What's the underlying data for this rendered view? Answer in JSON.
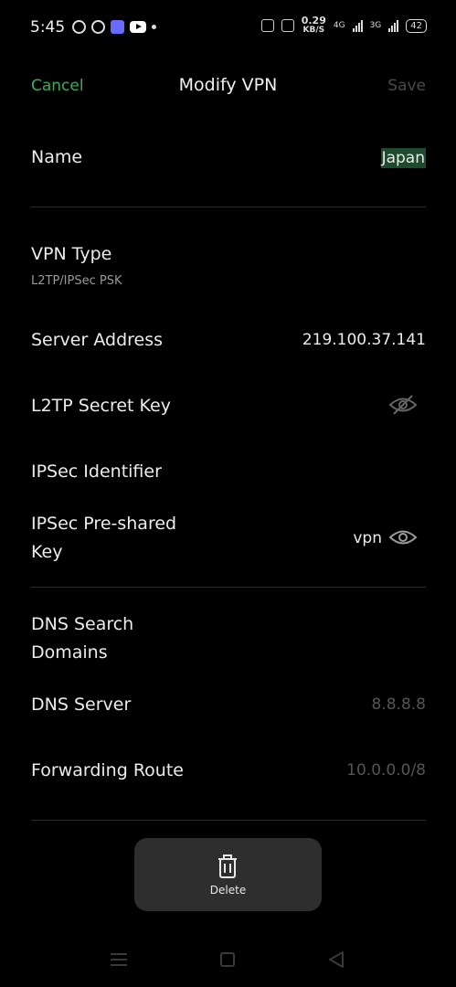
{
  "status_bar": {
    "time": "5:45",
    "speed_value": "0.29",
    "speed_unit": "KB/S",
    "network_1": "4G",
    "network_2": "3G",
    "battery": "42"
  },
  "header": {
    "cancel_label": "Cancel",
    "title": "Modify VPN",
    "save_label": "Save"
  },
  "fields": {
    "name": {
      "label": "Name",
      "value": "Japan"
    },
    "vpn_type": {
      "label": "VPN Type",
      "value": "L2TP/IPSec PSK"
    },
    "server_address": {
      "label": "Server Address",
      "value": "219.100.37.141"
    },
    "l2tp_secret": {
      "label": "L2TP Secret Key"
    },
    "ipsec_identifier": {
      "label": "IPSec Identifier"
    },
    "ipsec_psk": {
      "label_line1": "IPSec Pre-shared",
      "label_line2": "Key",
      "value": "vpn"
    },
    "dns_search": {
      "label_line1": "DNS Search",
      "label_line2": "Domains"
    },
    "dns_server": {
      "label": "DNS Server",
      "placeholder": "8.8.8.8"
    },
    "forwarding_route": {
      "label": "Forwarding Route",
      "placeholder": "10.0.0.0/8"
    }
  },
  "actions": {
    "delete_label": "Delete"
  },
  "colors": {
    "accent": "#3daa5e",
    "background": "#000000",
    "panel": "#2e2e2e",
    "name_highlight": "#1e4a2e"
  }
}
